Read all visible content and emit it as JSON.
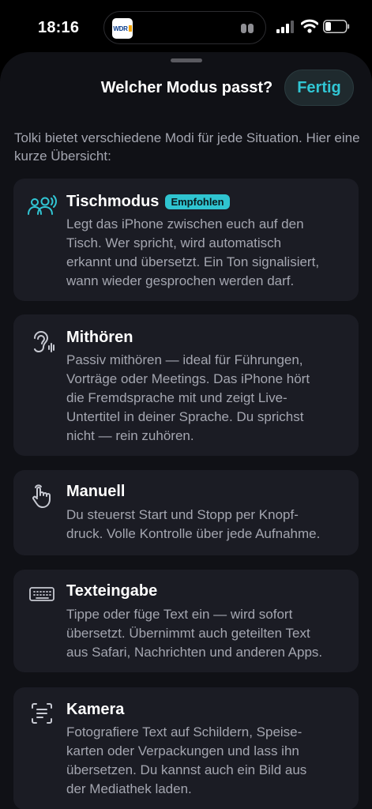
{
  "status_bar": {
    "time": "18:16",
    "island_logo": "WDR",
    "icons": [
      "wdr-logo-icon",
      "ear-pods-icon",
      "signal-icon",
      "wifi-icon",
      "battery-icon"
    ]
  },
  "sheet": {
    "title": "Welcher Modus passt?",
    "done_label": "Fertig",
    "intro": "Tolki bietet verschiedene Modi für jede Situation. Hier eine kurze Übersicht:"
  },
  "modes": [
    {
      "icon": "people-speaking-icon",
      "title": "Tischmodus",
      "badge": "Empfohlen",
      "lines": [
        "Legt das iPhone zwischen euch auf den",
        "Tisch. Wer spricht, wird automatisch",
        "erkannt und übersetzt. Ein Ton signalisiert,",
        "wann wieder gesprochen werden darf."
      ]
    },
    {
      "icon": "ear-icon",
      "title": "Mithören",
      "lines": [
        "Passiv mithören — ideal für Führungen,",
        "Vorträge oder Meetings. Das iPhone hört",
        "die Fremdsprache mit und zeigt Live-",
        "Untertitel in deiner Sprache. Du sprichst",
        "nicht — rein zuhören."
      ]
    },
    {
      "icon": "hand-tap-icon",
      "title": "Manuell",
      "lines": [
        "Du steuerst Start und Stopp per Knopf-",
        "druck. Volle Kontrolle über jede Aufnahme."
      ]
    },
    {
      "icon": "keyboard-icon",
      "title": "Texteingabe",
      "lines": [
        "Tippe oder füge Text ein — wird sofort",
        "übersetzt. Übernimmt auch geteilten Text",
        "aus Safari, Nachrichten und anderen Apps."
      ]
    },
    {
      "icon": "text-scan-icon",
      "title": "Kamera",
      "lines": [
        "Fotografiere Text auf Schildern, Speise-",
        "karten oder Verpackungen und lass ihn",
        "übersetzen. Du kannst auch ein Bild aus",
        "der Mediathek laden."
      ]
    }
  ],
  "colors": {
    "accent": "#31c6d4",
    "badge_bg": "#2fc4d0",
    "sheet_bg": "#101116",
    "card_bg": "#1b1c24",
    "secondary_text": "#a4a6b0"
  }
}
